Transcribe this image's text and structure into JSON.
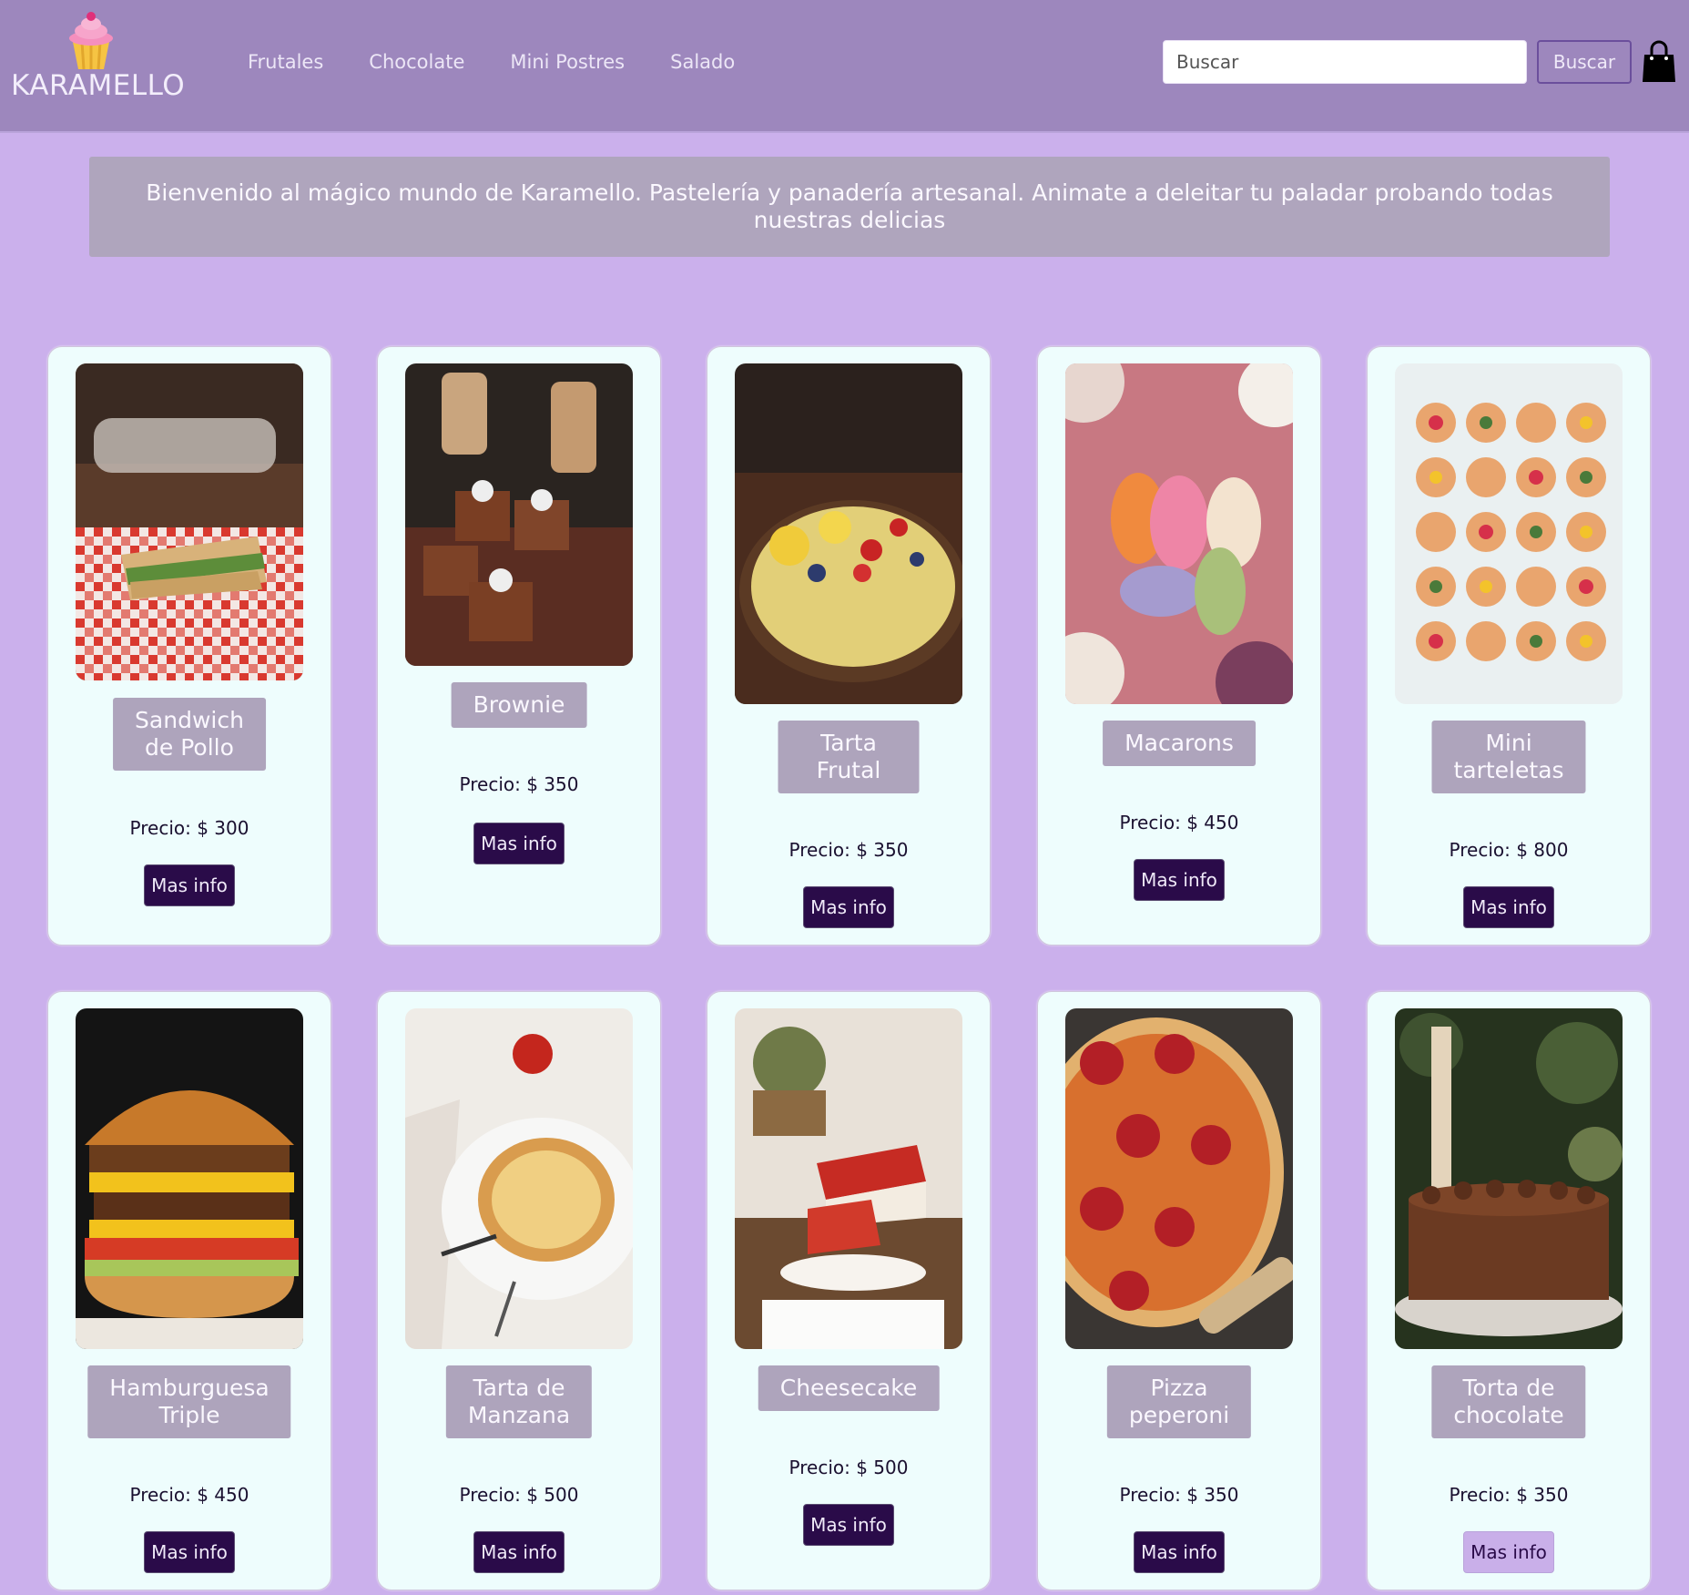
{
  "brand": {
    "name": "KARAMELLO"
  },
  "nav": [
    "Frutales",
    "Chocolate",
    "Mini Postres",
    "Salado"
  ],
  "search": {
    "placeholder": "Buscar",
    "button_label": "Buscar"
  },
  "banner": "Bienvenido al mágico mundo de Karamello. Pastelería y panadería artesanal. Animate a deleitar tu paladar probando todas nuestras delicias",
  "products": [
    {
      "name": "Sandwich de Pollo",
      "price": "Precio: $ 300",
      "button": "Mas info"
    },
    {
      "name": "Brownie",
      "price": "Precio: $ 350",
      "button": "Mas info"
    },
    {
      "name": "Tarta Frutal",
      "price": "Precio: $ 350",
      "button": "Mas info"
    },
    {
      "name": "Macarons",
      "price": "Precio: $ 450",
      "button": "Mas info"
    },
    {
      "name": "Mini tarteletas",
      "price": "Precio: $ 800",
      "button": "Mas info"
    },
    {
      "name": "Hamburguesa Triple",
      "price": "Precio: $ 450",
      "button": "Mas info"
    },
    {
      "name": "Tarta de Manzana",
      "price": "Precio: $ 500",
      "button": "Mas info"
    },
    {
      "name": "Cheesecake",
      "price": "Precio: $ 500",
      "button": "Mas info"
    },
    {
      "name": "Pizza peperoni",
      "price": "Precio: $ 350",
      "button": "Mas info"
    },
    {
      "name": "Torta de chocolate",
      "price": "Precio: $ 350",
      "button": "Mas info"
    }
  ],
  "colors": {
    "header_bg": "#9d87bd",
    "page_bg": "#cbb0ec",
    "card_bg": "#eefdfd",
    "name_badge_bg": "#aea4bc",
    "button_bg": "#2a0b49"
  },
  "icons": {
    "logo": "cupcake-icon",
    "cart": "shopping-bag-icon"
  }
}
